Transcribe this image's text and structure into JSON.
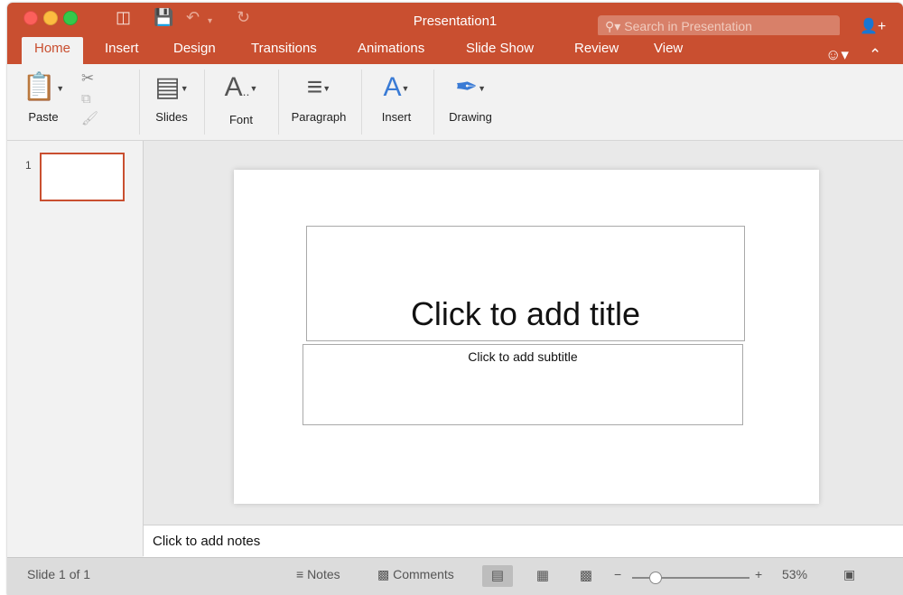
{
  "window": {
    "title": "Presentation1",
    "search_placeholder": "Search in Presentation"
  },
  "tabs": [
    {
      "label": "Home",
      "active": true
    },
    {
      "label": "Insert"
    },
    {
      "label": "Design"
    },
    {
      "label": "Transitions"
    },
    {
      "label": "Animations"
    },
    {
      "label": "Slide Show"
    },
    {
      "label": "Review"
    },
    {
      "label": "View"
    }
  ],
  "ribbon": {
    "paste": "Paste",
    "slides": "Slides",
    "font": "Font",
    "paragraph": "Paragraph",
    "insert": "Insert",
    "drawing": "Drawing"
  },
  "thumbnails": [
    {
      "number": "1"
    }
  ],
  "slide": {
    "title_placeholder": "Click to add title",
    "subtitle_placeholder": "Click to add subtitle"
  },
  "notes_placeholder": "Click to add notes",
  "status": {
    "slide_indicator": "Slide 1 of 1",
    "notes": "Notes",
    "comments": "Comments",
    "zoom": "53%",
    "zoom_level": 0.2
  },
  "colors": {
    "accent": "#c94f30"
  }
}
